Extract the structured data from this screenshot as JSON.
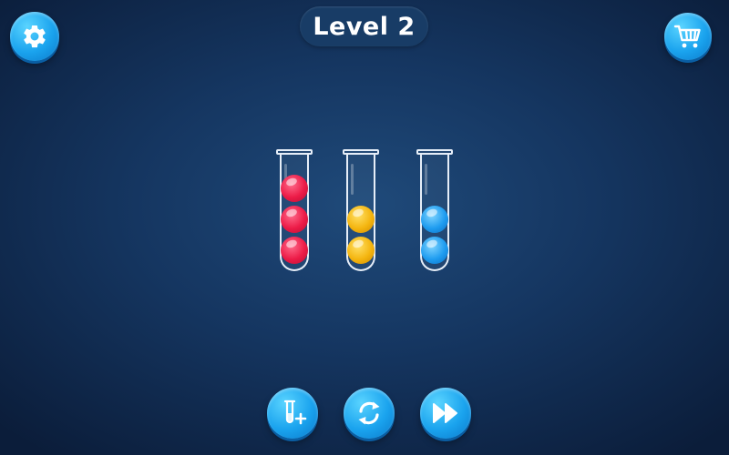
{
  "header": {
    "level_label": "Level 2"
  },
  "buttons": {
    "settings_icon": "gear-icon",
    "shop_icon": "shopping-cart-icon",
    "add_tube_icon": "add-tube-icon",
    "restart_icon": "restart-icon",
    "skip_icon": "fast-forward-icon"
  },
  "board": {
    "tubes": [
      {
        "balls": [
          "red",
          "red",
          "red"
        ]
      },
      {
        "balls": [
          "yellow",
          "yellow"
        ]
      },
      {
        "balls": [
          "blue",
          "blue"
        ]
      }
    ]
  },
  "colors": {
    "background": "#153661",
    "button": "#1aa3ee",
    "level_pill": "#183c66",
    "red": "#ec1b47",
    "yellow": "#f4b50f",
    "blue": "#1e9cf0"
  }
}
